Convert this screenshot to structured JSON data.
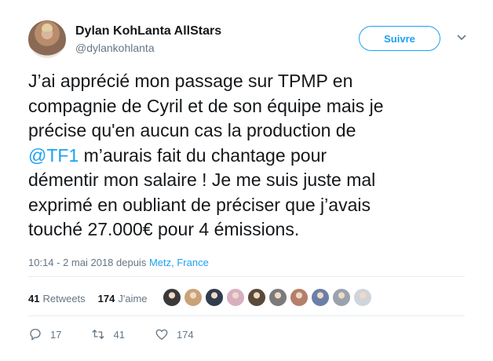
{
  "header": {
    "display_name": "Dylan KohLanta AllStars",
    "handle": "@dylankohlanta",
    "follow_label": "Suivre"
  },
  "tweet": {
    "lines": [
      "J’ai apprécié mon passage sur TPMP en",
      "compagnie de Cyril et de son équipe mais je",
      "précise qu'en aucun cas la production de",
      "m’aurais fait du chantage pour",
      "démentir mon salaire ! Je me suis juste mal",
      "exprimé en oubliant de préciser que j’avais",
      "touché 27.000€ pour 4 émissions."
    ],
    "mention": "@TF1"
  },
  "meta": {
    "timestamp": "10:14 - 2 mai 2018 depuis",
    "location": "Metz, France"
  },
  "stats": {
    "retweets_count": "41",
    "retweets_label": "Retweets",
    "likes_count": "174",
    "likes_label": "J'aime",
    "liker_colors": [
      "#3a3a3a",
      "#c9a27a",
      "#2f3d4f",
      "#d8b0c0",
      "#5a4a3a",
      "#7b7b7b",
      "#b57f6a",
      "#6c7fa8",
      "#9aa3ad",
      "#cfd5db"
    ]
  },
  "actions": {
    "reply_count": "17",
    "retweet_count": "41",
    "like_count": "174"
  },
  "colors": {
    "accent": "#1da1f2",
    "secondary_text": "#657786",
    "text": "#14171a"
  }
}
